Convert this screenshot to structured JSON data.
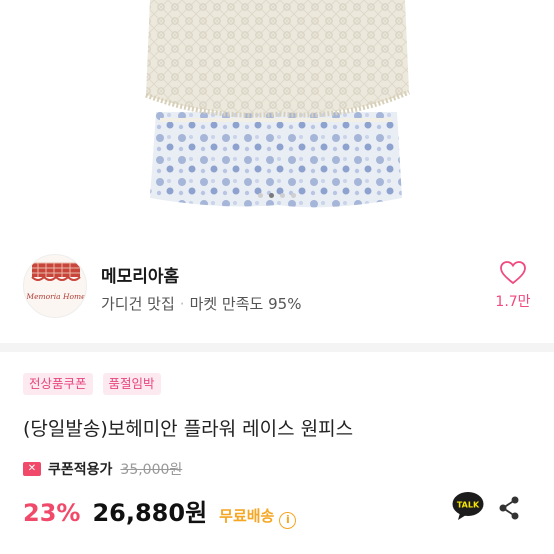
{
  "image": {
    "alt": "",
    "pager": {
      "count": 4,
      "active": 1
    }
  },
  "shop": {
    "name": "메모리아홈",
    "logo_text": "Memoria Home",
    "category": "가디건 맛집",
    "satisfaction_label": "마켓 만족도",
    "satisfaction_value": "95%",
    "likes": "1.7만"
  },
  "product": {
    "badges": [
      "전상품쿠폰",
      "품절임박"
    ],
    "title": "(당일발송)보헤미안 플라워 레이스 원피스",
    "coupon_label": "쿠폰적용가",
    "coupon_icon": "ticket-icon",
    "original_price": "35,000원",
    "discount": "23%",
    "price": "26,880원",
    "shipping": "무료배송",
    "shipping_info_icon": "info-icon"
  },
  "actions": {
    "talk_label": "TALK",
    "share_icon": "share-icon",
    "like_icon": "heart-icon"
  },
  "colors": {
    "accent": "#f0496a",
    "like": "#f04a7e",
    "shipping": "#f5a623",
    "badge_bg": "#fdeaf1"
  }
}
